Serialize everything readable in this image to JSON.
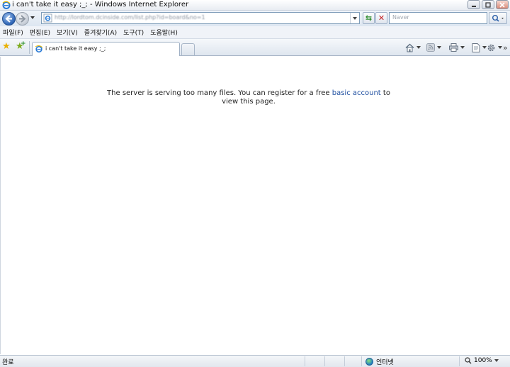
{
  "window": {
    "title": "i can't take it easy ;_; - Windows Internet Explorer"
  },
  "address_bar": {
    "url": "http://lordtom.dcinside.com/list.php?id=board&no=1"
  },
  "search": {
    "placeholder": "Naver"
  },
  "menu": [
    "파일(F)",
    "편집(E)",
    "보기(V)",
    "즐겨찾기(A)",
    "도구(T)",
    "도움말(H)"
  ],
  "tab": {
    "label": "i can't take it easy ;_;"
  },
  "content": {
    "message_before": "The server is serving too many files. You can register for a free ",
    "link_text": "basic account",
    "message_after": " to view this page."
  },
  "status": {
    "text": "완료",
    "zone": "인터넷",
    "zoom": "100%"
  },
  "icons": [
    "ie-icon",
    "minimize-icon",
    "maximize-icon",
    "close-icon",
    "back-arrow-icon",
    "forward-arrow-icon",
    "refresh-icon",
    "stop-icon",
    "search-icon",
    "favorites-star-icon",
    "add-favorites-icon",
    "home-icon",
    "feeds-icon",
    "print-icon",
    "page-icon",
    "tools-gear-icon",
    "globe-icon",
    "zoom-icon"
  ]
}
